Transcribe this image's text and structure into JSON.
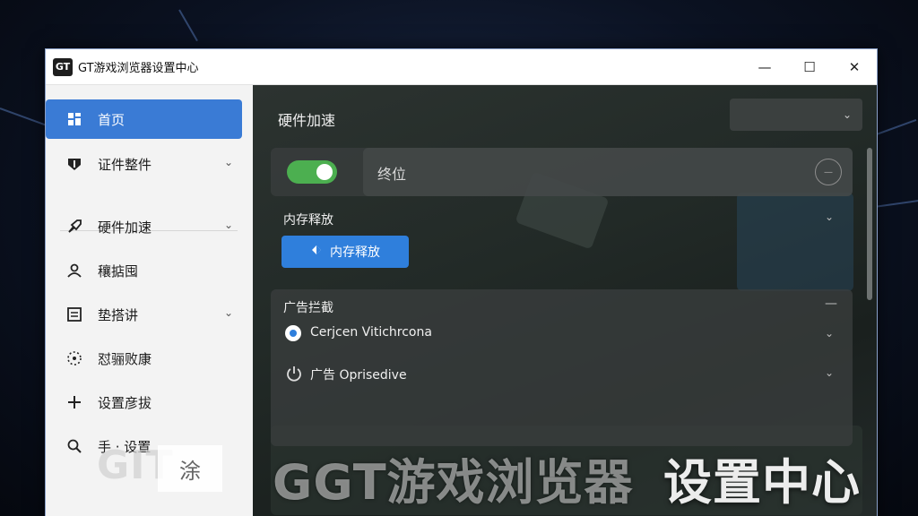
{
  "window": {
    "logo_text": "GT",
    "title": "GT游戏浏览器设置中心",
    "controls": {
      "minimize": "—",
      "maximize": "☐",
      "close": "✕"
    }
  },
  "sidebar": {
    "items": [
      {
        "label": "首页",
        "icon": "dashboard-icon",
        "active": true,
        "has_chevron": false
      },
      {
        "label": "证件整件",
        "icon": "shield-icon",
        "active": false,
        "has_chevron": true
      },
      {
        "label": "硬件加速",
        "icon": "rocket-icon",
        "active": false,
        "has_chevron": true
      },
      {
        "label": "穰掂囤",
        "icon": "user-icon",
        "active": false,
        "has_chevron": false
      },
      {
        "label": "垫搭讲",
        "icon": "document-icon",
        "active": false,
        "has_chevron": true
      },
      {
        "label": "怼骊败康",
        "icon": "gear-dots-icon",
        "active": false,
        "has_chevron": false
      },
      {
        "label": "设置彦拔",
        "icon": "plus-icon",
        "active": false,
        "has_chevron": false
      },
      {
        "label": "手 · 设置",
        "icon": "search-icon",
        "active": false,
        "has_chevron": false
      }
    ]
  },
  "main": {
    "section_title": "硬件加速",
    "top_dropdown": {
      "value": "",
      "chevron": "⌄"
    },
    "toggle_row": {
      "enabled": true,
      "sub_label": "终位"
    },
    "memory": {
      "label": "内存释放",
      "button_label": "内存释放"
    },
    "adblock": {
      "label": "广告拦截",
      "collapse_symbol": "—",
      "options": [
        {
          "text": "Cerjcen Vitichrcona",
          "type": "radio",
          "selected": true
        },
        {
          "text": "广告 Oprisedive",
          "type": "power",
          "selected": false
        }
      ]
    }
  },
  "watermark": {
    "left_text": "GIT",
    "left_box_text": "涂",
    "main_text": "GGT游戏浏览器",
    "right_text": "设置中心"
  },
  "colors": {
    "accent": "#3a7bd5",
    "button_blue": "#2f7fdc",
    "toggle_on": "#4caf50",
    "content_bg": "#222a27"
  }
}
